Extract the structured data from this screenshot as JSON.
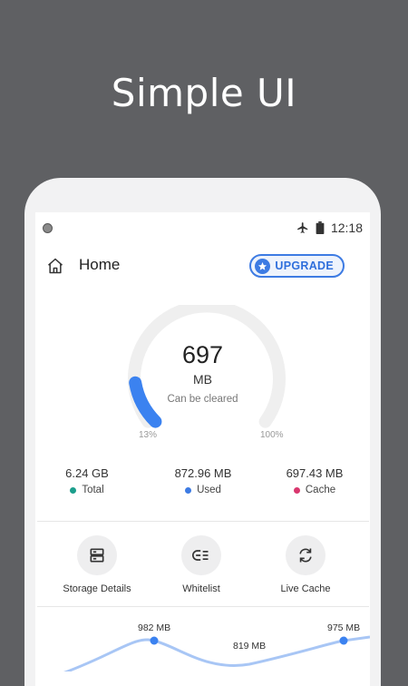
{
  "headline": "Simple UI",
  "status_bar": {
    "time": "12:18",
    "icons": [
      "airplane-icon",
      "battery-icon"
    ]
  },
  "app_bar": {
    "title": "Home",
    "upgrade_label": "UPGRADE"
  },
  "gauge": {
    "value": "697",
    "unit": "MB",
    "caption": "Can be cleared",
    "min_label": "13%",
    "max_label": "100%",
    "fill_fraction": 0.13,
    "accent_color": "#3b82f0"
  },
  "stats": [
    {
      "value": "6.24 GB",
      "label": "Total",
      "color": "#1b9e8c"
    },
    {
      "value": "872.96 MB",
      "label": "Used",
      "color": "#3d7be3"
    },
    {
      "value": "697.43 MB",
      "label": "Cache",
      "color": "#d9376e"
    }
  ],
  "actions": [
    {
      "label": "Storage Details",
      "icon": "storage-icon"
    },
    {
      "label": "Whitelist",
      "icon": "whitelist-icon"
    },
    {
      "label": "Live Cache",
      "icon": "refresh-icon"
    }
  ],
  "mini_chart": {
    "labels": [
      "982 MB",
      "819 MB",
      "975 MB"
    ]
  }
}
